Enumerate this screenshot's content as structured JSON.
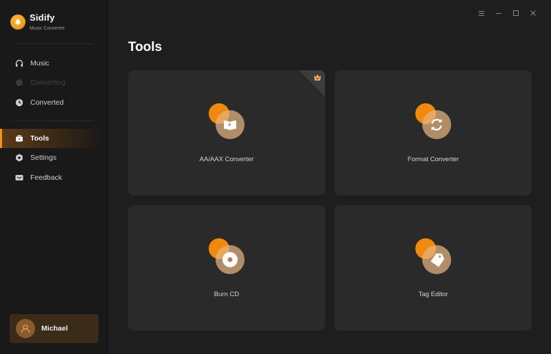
{
  "brand": {
    "name": "Sidify",
    "subtitle": "Music Converter"
  },
  "sidebar": {
    "items": [
      {
        "id": "music",
        "label": "Music",
        "icon": "headphones-icon",
        "state": "normal"
      },
      {
        "id": "converting",
        "label": "Converting",
        "icon": "converting-icon",
        "state": "disabled"
      },
      {
        "id": "converted",
        "label": "Converted",
        "icon": "clock-icon",
        "state": "normal"
      },
      {
        "id": "tools",
        "label": "Tools",
        "icon": "toolbox-icon",
        "state": "active"
      },
      {
        "id": "settings",
        "label": "Settings",
        "icon": "gear-icon",
        "state": "normal"
      },
      {
        "id": "feedback",
        "label": "Feedback",
        "icon": "mail-icon",
        "state": "normal"
      }
    ]
  },
  "user": {
    "name": "Michael"
  },
  "window_controls": [
    "menu",
    "minimize",
    "maximize",
    "close"
  ],
  "main": {
    "title": "Tools",
    "tools": [
      {
        "label": "AA/AAX Converter",
        "icon": "audiobook-icon",
        "badge": "premium-badge"
      },
      {
        "label": "Format Converter",
        "icon": "refresh-icon"
      },
      {
        "label": "Burn CD",
        "icon": "cd-icon"
      },
      {
        "label": "Tag Editor",
        "icon": "tag-icon"
      }
    ]
  },
  "colors": {
    "accent": "#f08a0e",
    "sidebar_bg": "#191919",
    "card_bg": "#2a2a2a"
  }
}
